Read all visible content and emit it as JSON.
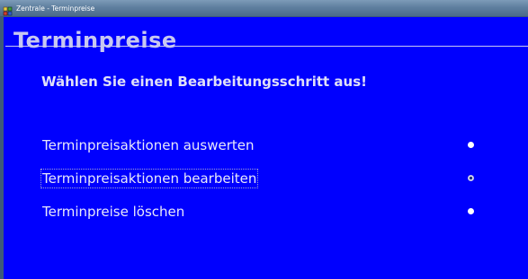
{
  "window": {
    "title": "Zentrale - Terminpreise"
  },
  "page": {
    "title": "Terminpreise",
    "instruction": "Wählen Sie einen Bearbeitungsschritt aus!"
  },
  "options": [
    {
      "label": "Terminpreisaktionen auswerten",
      "selected": false
    },
    {
      "label": "Terminpreisaktionen bearbeiten",
      "selected": true,
      "focused": true
    },
    {
      "label": "Terminpreise löschen",
      "selected": false
    }
  ],
  "colors": {
    "background": "#0000fe",
    "text": "#e8e8fa",
    "titlebar": "#5f7f9f"
  },
  "icons": {
    "app": "app-icon"
  }
}
